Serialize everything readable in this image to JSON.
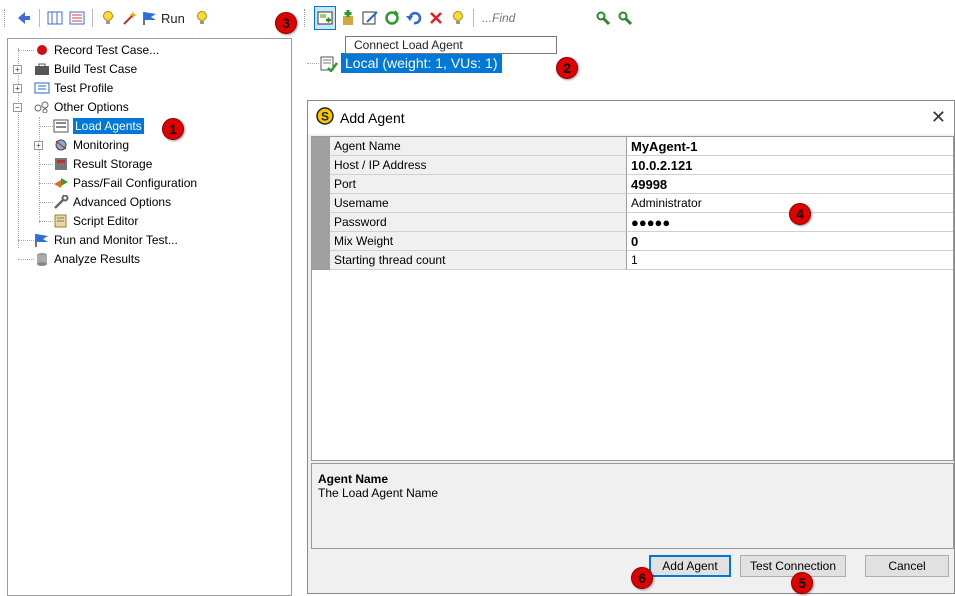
{
  "toolbar_left": {
    "run_label": "Run"
  },
  "toolbar_right": {
    "find_placeholder": "...Find"
  },
  "tooltip": {
    "text": "Connect Load Agent"
  },
  "tree": {
    "items": [
      {
        "label": "Record Test Case..."
      },
      {
        "label": "Build Test Case"
      },
      {
        "label": "Test Profile"
      },
      {
        "label": "Other Options"
      },
      {
        "label": "Load Agents"
      },
      {
        "label": "Monitoring"
      },
      {
        "label": "Result Storage"
      },
      {
        "label": "Pass/Fail Configuration"
      },
      {
        "label": "Advanced Options"
      },
      {
        "label": "Script Editor"
      },
      {
        "label": "Run and Monitor Test..."
      },
      {
        "label": "Analyze Results"
      }
    ]
  },
  "agent_node": {
    "label": "Local (weight: 1, VUs: 1)"
  },
  "dialog": {
    "title": "Add Agent",
    "close": "✕",
    "properties": [
      {
        "name": "Agent Name",
        "value": "MyAgent-1"
      },
      {
        "name": "Host / IP Address",
        "value": "10.0.2.121"
      },
      {
        "name": "Port",
        "value": "49998"
      },
      {
        "name": "Usemame",
        "value": "Administrator"
      },
      {
        "name": "Password",
        "value": "●●●●●"
      },
      {
        "name": "Mix Weight",
        "value": "0"
      },
      {
        "name": "Starting thread count",
        "value": "1"
      }
    ],
    "description_title": "Agent Name",
    "description_text": "The Load Agent Name",
    "buttons": {
      "add": "Add Agent",
      "test": "Test Connection",
      "cancel": "Cancel"
    }
  },
  "callouts": [
    "1",
    "2",
    "3",
    "4",
    "5",
    "6"
  ],
  "colors": {
    "selection": "#0078d7",
    "callout": "#e00000"
  }
}
